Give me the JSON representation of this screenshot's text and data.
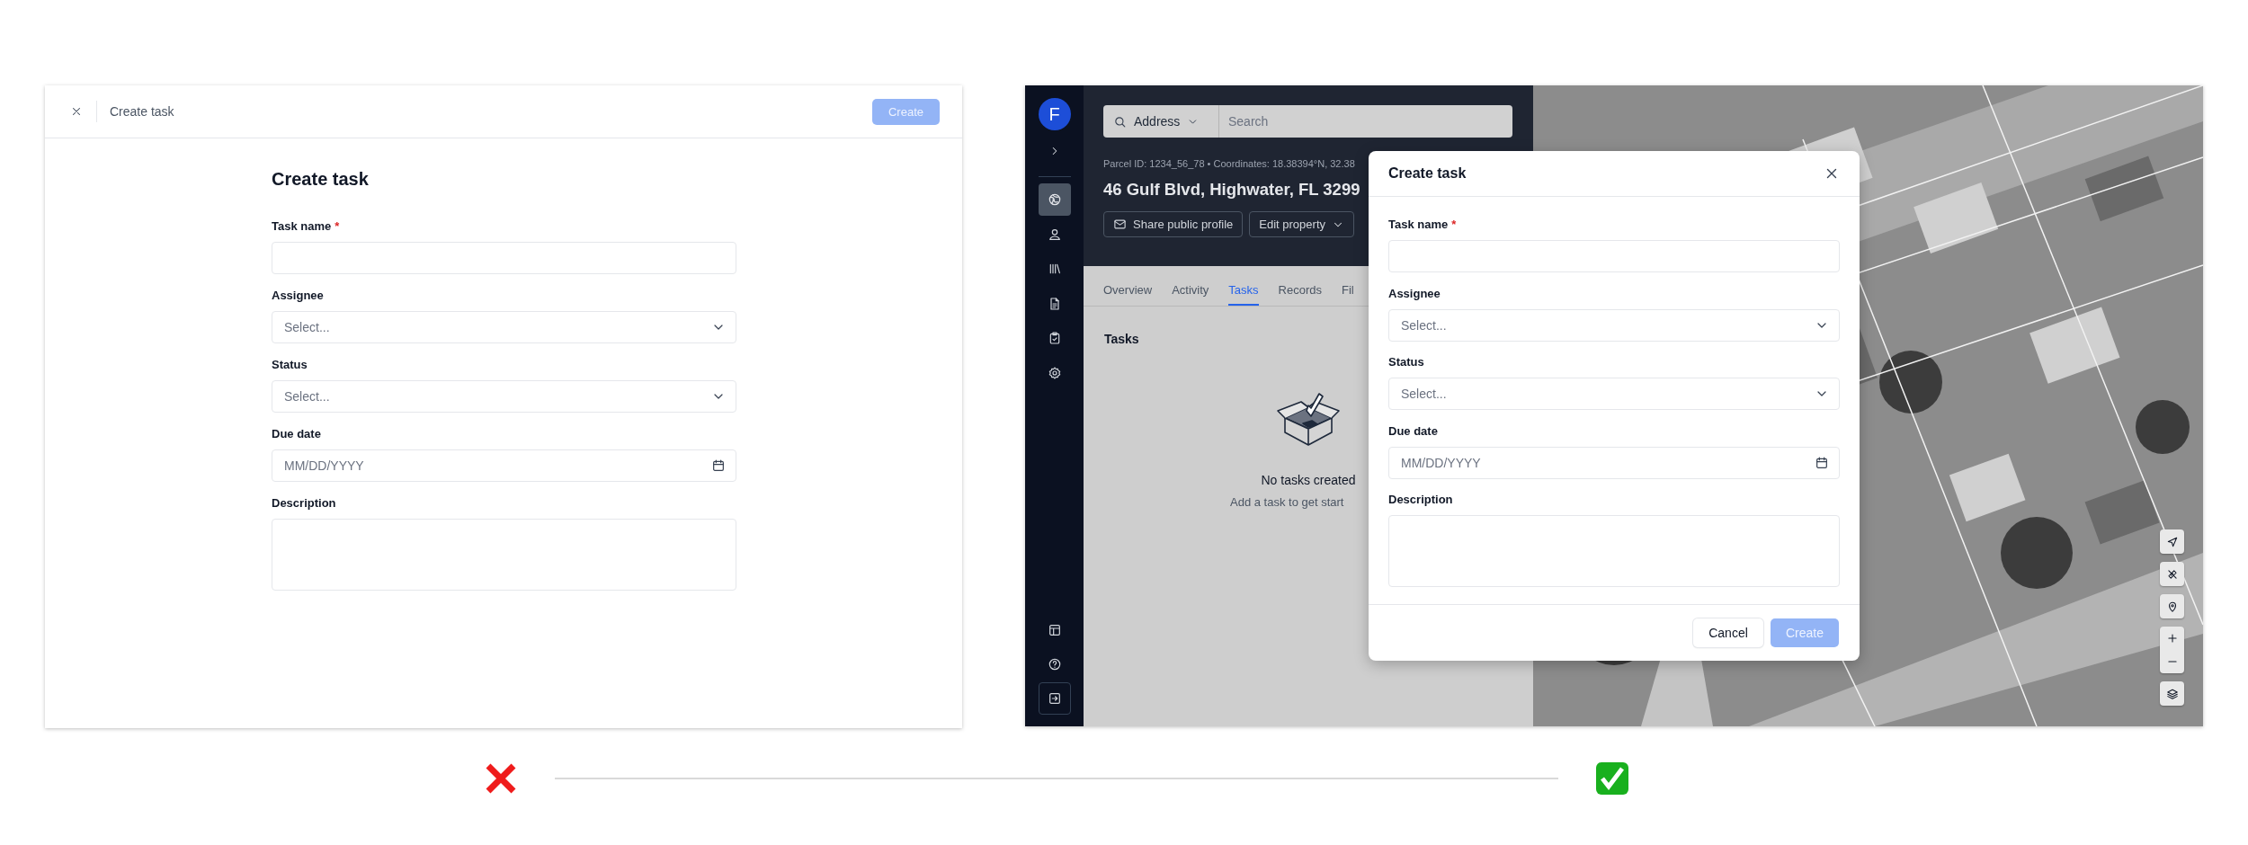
{
  "before_panel": {
    "header": {
      "title": "Create task",
      "create_button": {
        "label": "Create",
        "kind": "primary",
        "disabled": true
      }
    },
    "form": {
      "title": "Create task",
      "fields": [
        {
          "kind": "text",
          "label": "Task name",
          "required_mark": "*"
        },
        {
          "kind": "select",
          "label": "Assignee",
          "placeholder": "Select..."
        },
        {
          "kind": "select",
          "label": "Status",
          "placeholder": "Select..."
        },
        {
          "kind": "date",
          "label": "Due date",
          "placeholder": "MM/DD/YYYY"
        },
        {
          "kind": "textarea",
          "label": "Description"
        }
      ]
    }
  },
  "after_panel": {
    "sidebar": {
      "avatar": "F",
      "items": [
        {
          "selected": true
        },
        {
          "selected": false
        },
        {
          "selected": false
        },
        {
          "selected": false
        },
        {
          "selected": false
        },
        {
          "selected": false
        }
      ]
    },
    "header": {
      "search_scope": "Address",
      "search": {
        "placeholder": "Search"
      },
      "parcel_info": "Parcel ID: 1234_56_78 • Coordinates: 18.38394°N, 32.38",
      "address": "46 Gulf Blvd, Highwater, FL 3299",
      "actions": [
        "Share public profile",
        "Edit property"
      ]
    },
    "tabs": [
      {
        "label": "Overview",
        "selected": false
      },
      {
        "label": "Activity",
        "selected": false
      },
      {
        "label": "Tasks",
        "selected": true
      },
      {
        "label": "Records",
        "selected": false
      },
      {
        "label": "Fil",
        "selected": false
      }
    ],
    "section_title": "Tasks",
    "empty_state": {
      "title": "No tasks created",
      "subtitle": "Add a task to get start"
    },
    "modal": {
      "title": "Create task",
      "fields": [
        {
          "kind": "text",
          "label": "Task name",
          "required_mark": "*"
        },
        {
          "kind": "select",
          "label": "Assignee",
          "placeholder": "Select..."
        },
        {
          "kind": "select",
          "label": "Status",
          "placeholder": "Select..."
        },
        {
          "kind": "date",
          "label": "Due date",
          "placeholder": "MM/DD/YYYY"
        },
        {
          "kind": "textarea",
          "label": "Description"
        }
      ],
      "buttons": [
        {
          "label": "Cancel",
          "kind": "secondary",
          "disabled": false
        },
        {
          "label": "Create",
          "kind": "primary",
          "disabled": true
        }
      ]
    }
  }
}
